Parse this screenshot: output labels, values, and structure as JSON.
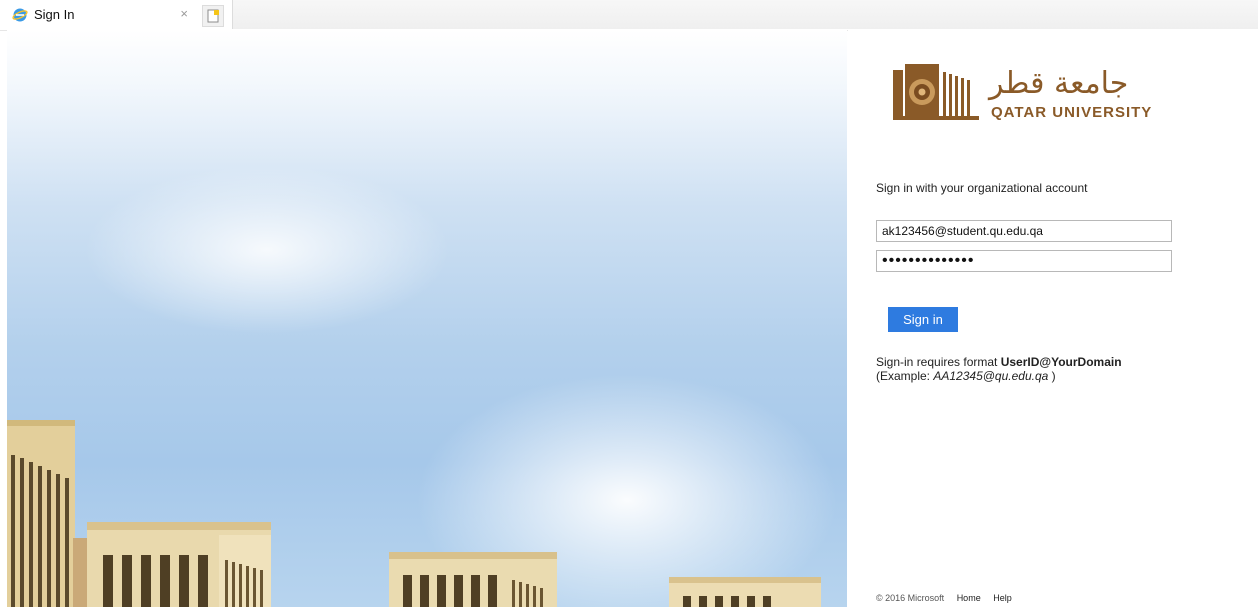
{
  "tab": {
    "title": "Sign In",
    "close_label": "×"
  },
  "brand": {
    "arabic_name": "جامعة قطر",
    "english_name": "QATAR UNIVERSITY",
    "color": "#8a5a28"
  },
  "form": {
    "heading": "Sign in with your organizational account",
    "email_value": "ak123456@student.qu.edu.qa",
    "password_value": "••••••••••••••",
    "submit_label": "Sign in",
    "accent_color": "#2e7be0"
  },
  "note": {
    "prefix": "Sign-in requires format ",
    "format": "UserID@YourDomain",
    "example_prefix": "(Example: ",
    "example": "AA12345@qu.edu.qa",
    "example_suffix": " )"
  },
  "footer": {
    "copyright": "© 2016 Microsoft",
    "links": [
      "Home",
      "Help"
    ]
  },
  "icons": [
    "ie-icon",
    "new-tab-icon",
    "qu-logo-icon"
  ]
}
